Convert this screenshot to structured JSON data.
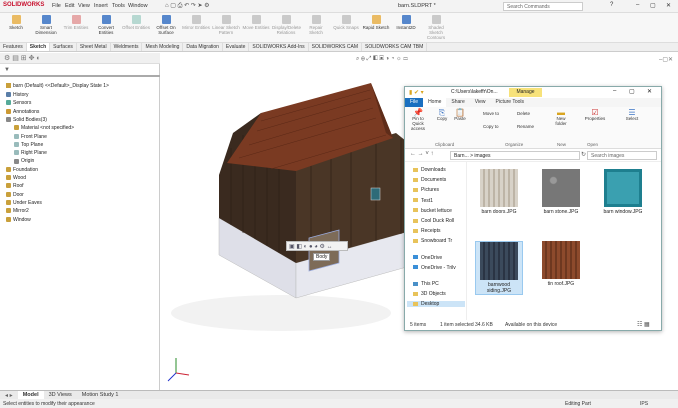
{
  "app": {
    "logo": "SOLIDWORKS",
    "doc_name": "barn.SLDPRT *",
    "search_placeholder": "Search Commands"
  },
  "menu": [
    "File",
    "Edit",
    "View",
    "Insert",
    "Tools",
    "Window"
  ],
  "ribbon": {
    "tools": [
      {
        "label": "Sketch",
        "dim": false
      },
      {
        "label": "Smart Dimension",
        "dim": false
      },
      {
        "label": "Trim Entities",
        "dim": true
      },
      {
        "label": "Convert Entities",
        "dim": false
      },
      {
        "label": "Offset Entities",
        "dim": true
      },
      {
        "label": "Offset On Surface",
        "dim": false
      },
      {
        "label": "Mirror Entities",
        "dim": true
      },
      {
        "label": "Linear Sketch Pattern",
        "dim": true
      },
      {
        "label": "Move Entities",
        "dim": true
      },
      {
        "label": "Display/Delete Relations",
        "dim": true
      },
      {
        "label": "Repair Sketch",
        "dim": true
      },
      {
        "label": "Quick Snaps",
        "dim": true
      },
      {
        "label": "Rapid Sketch",
        "dim": false
      },
      {
        "label": "Instant2D",
        "dim": false
      },
      {
        "label": "Shaded Sketch Contours",
        "dim": true
      }
    ]
  },
  "tabs": [
    "Features",
    "Sketch",
    "Surfaces",
    "Sheet Metal",
    "Weldments",
    "Mesh Modeling",
    "Data Migration",
    "Evaluate",
    "SOLIDWORKS Add-Ins",
    "SOLIDWORKS CAM",
    "SOLIDWORKS CAM TBM"
  ],
  "active_tab": "Sketch",
  "tree": {
    "title": "barn (Default) <<Default>_Display State 1>",
    "items": [
      "History",
      "Sensors",
      "Annotations",
      "Solid Bodies(3)",
      "Material <not specified>",
      "Front Plane",
      "Top Plane",
      "Right Plane",
      "Origin",
      "Foundation",
      "Wood",
      "Roof",
      "Door",
      "Under Eaves",
      "Mirror2",
      "Window"
    ]
  },
  "context_toolbar": {
    "tooltip": "Body"
  },
  "explorer": {
    "path_title": "C:\\Users\\lakeffr\\On...",
    "manage_tab": "Manage",
    "tabs": [
      "File",
      "Home",
      "Share",
      "View",
      "Picture Tools"
    ],
    "ribbon_buttons": [
      "Pin to Quick access",
      "Copy",
      "Paste",
      "Move to",
      "Delete",
      "Copy to",
      "Rename",
      "New folder",
      "Properties",
      "Select"
    ],
    "ribbon_groups": [
      "Clipboard",
      "Organize",
      "New",
      "Open"
    ],
    "breadcrumb": "Barn... > images",
    "search_placeholder": "Search images",
    "nav": [
      "Downloads",
      "Documents",
      "Pictures",
      "Test1",
      "bucket lettuce",
      "Cool Duck Roll",
      "Receipts",
      "Snowboard Tr",
      "OneDrive",
      "OneDrive - Trilv",
      "This PC",
      "3D Objects",
      "Desktop"
    ],
    "nav_selected": "Desktop",
    "files": [
      {
        "name": "barn doors.JPG",
        "selected": false
      },
      {
        "name": "barn stone.JPG",
        "selected": false
      },
      {
        "name": "barn window.JPG",
        "selected": false
      },
      {
        "name": "barnwood siding.JPG",
        "selected": true
      },
      {
        "name": "tin roof.JPG",
        "selected": false
      }
    ],
    "status": {
      "items": "5 items",
      "selected": "1 item selected 34.6 KB",
      "availability": "Available on this device"
    }
  },
  "bottom_tabs": [
    "Model",
    "3D Views",
    "Motion Study 1"
  ],
  "status_bar": {
    "left": "Select entities to modify their appearance",
    "mode": "Editing Part",
    "units": "IPS"
  }
}
